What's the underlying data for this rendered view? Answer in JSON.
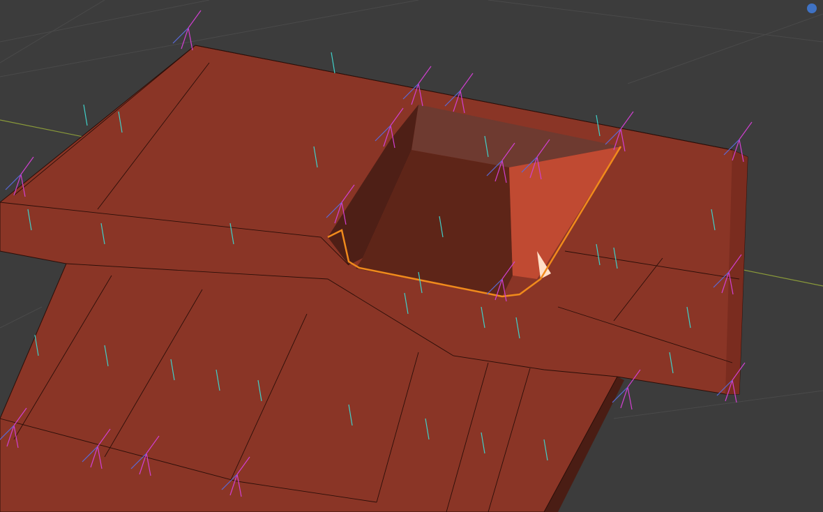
{
  "viewport": {
    "background": "#3c3c3c",
    "grid_color": "#4a4a4a",
    "x_axis_color": "#8a9a3a",
    "mesh_color": "#8a3526",
    "mesh_edge_color": "#2a0e08",
    "cavity_color": "#5a2418",
    "selection_color": "#f08a1c",
    "normal_face_color": "#40d0c8",
    "normal_vertex_color": "#d040d0",
    "normal_split_color": "#5a6ad8"
  },
  "gizmo": {
    "icon": "navigation-dot-icon",
    "color": "#3f72c4"
  }
}
